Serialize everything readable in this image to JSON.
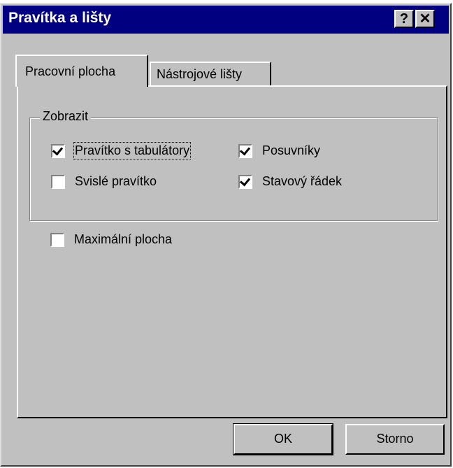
{
  "window": {
    "title": "Pravítka a lišty",
    "help_label": "?",
    "close_label": "✕"
  },
  "tabs": [
    {
      "label": "Pracovní plocha",
      "active": true
    },
    {
      "label": "Nástrojové lišty",
      "active": false
    }
  ],
  "group": {
    "label": "Zobrazit",
    "options": [
      {
        "label": "Pravítko s tabulátory",
        "checked": true
      },
      {
        "label": "Posuvníky",
        "checked": true
      },
      {
        "label": "Svislé pravítko",
        "checked": false
      },
      {
        "label": "Stavový řádek",
        "checked": true
      }
    ]
  },
  "maximize": {
    "label": "Maximální plocha",
    "checked": false
  },
  "buttons": {
    "ok": "OK",
    "cancel": "Storno"
  },
  "colors": {
    "titlebar": "#000080",
    "face": "#c0c0c0"
  }
}
